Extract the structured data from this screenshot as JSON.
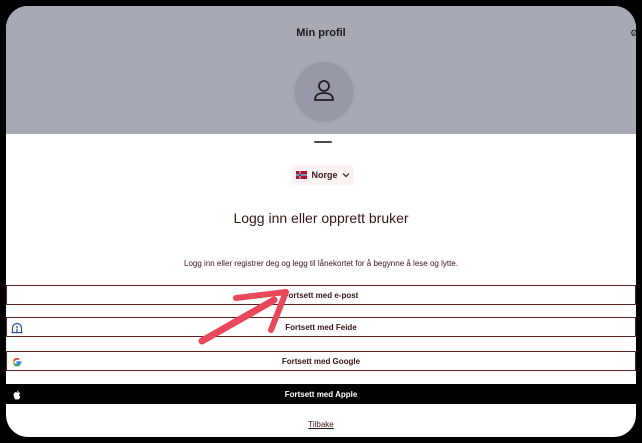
{
  "header": {
    "title": "Min profil"
  },
  "country_select": {
    "label": "Norge"
  },
  "login": {
    "title": "Logg inn eller opprett bruker",
    "description": "Logg inn eller registrer deg og legg til lånekortet for å begynne å lese og lytte."
  },
  "buttons": {
    "email": "Fortsett med e-post",
    "feide": "Fortsett med Feide",
    "google": "Fortsett med Google",
    "apple": "Fortsett med Apple"
  },
  "back_link": "Tilbake",
  "icons": {
    "avatar": "user-icon",
    "flag": "norway-flag-icon",
    "feide": "feide-icon",
    "google": "google-icon",
    "apple": "apple-icon",
    "annotation": "arrow-annotation"
  },
  "colors": {
    "header_bg": "#a7a9b5",
    "avatar_bg": "#979aa6",
    "text_dark": "#3a1515",
    "border": "#5a1f1f",
    "arrow": "#e8485a",
    "apple_bg": "#000000"
  }
}
